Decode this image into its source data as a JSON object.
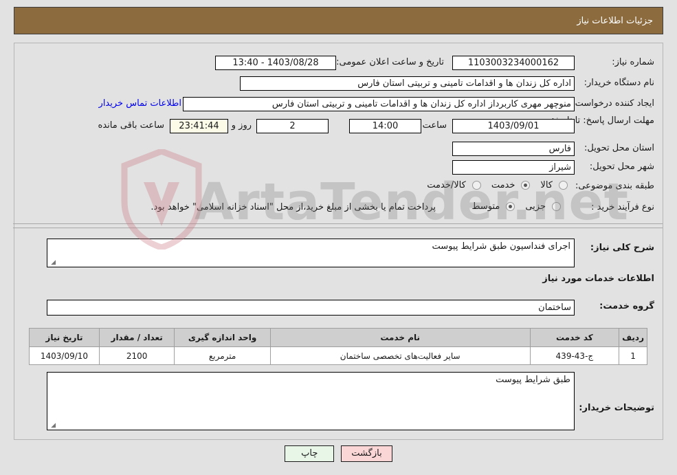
{
  "header": {
    "title": "جزئیات اطلاعات نیاز"
  },
  "fields": {
    "need_number_label": "شماره نیاز:",
    "need_number_value": "1103003234000162",
    "announce_label": "تاریخ و ساعت اعلان عمومی:",
    "announce_value": "1403/08/28 - 13:40",
    "buyer_org_label": "نام دستگاه خریدار:",
    "buyer_org_value": "اداره کل زندان ها و اقدامات تامینی و تربیتی استان فارس",
    "creator_label": "ایجاد کننده درخواست:",
    "creator_value": "منوچهر  مهری  کاربرداز اداره کل زندان ها و اقدامات تامینی و تربیتی استان فارس",
    "contact_link": "اطلاعات تماس خریدار",
    "deadline_label": "مهلت ارسال پاسخ: تا تاریخ:",
    "deadline_date": "1403/09/01",
    "deadline_hour_label": "ساعت",
    "deadline_hour": "14:00",
    "remaining_days": "2",
    "remaining_days_label": "روز و",
    "remaining_time": "23:41:44",
    "remaining_time_label": "ساعت باقی مانده",
    "province_label": "استان محل تحویل:",
    "province_value": "فارس",
    "city_label": "شهر محل تحویل:",
    "city_value": "شیراز",
    "category_label": "طبقه بندی موضوعی:",
    "process_label": "نوع فرآیند خرید :",
    "payment_note": "پرداخت تمام یا بخشی از مبلغ خرید،از محل \"اسناد خزانه اسلامی\" خواهد بود.",
    "general_desc_label": "شرح کلی نیاز:",
    "general_desc_value": "اجرای فنداسیون  طبق شرایط پیوست",
    "services_section_title": "اطلاعات خدمات مورد نیاز",
    "service_group_label": "گروه خدمت:",
    "service_group_value": "ساختمان",
    "buyer_notes_label": "توضیحات خریدار:",
    "buyer_notes_value": "طبق شرایط پیوست"
  },
  "category_options": [
    {
      "label": "کالا",
      "selected": false
    },
    {
      "label": "خدمت",
      "selected": true
    },
    {
      "label": "کالا/خدمت",
      "selected": false
    }
  ],
  "process_options": [
    {
      "label": "جزیی",
      "selected": false
    },
    {
      "label": "متوسط",
      "selected": true
    }
  ],
  "table": {
    "headers": [
      "ردیف",
      "کد خدمت",
      "نام خدمت",
      "واحد اندازه گیری",
      "تعداد / مقدار",
      "تاریخ نیاز"
    ],
    "rows": [
      {
        "radif": "1",
        "code": "ج-43-439",
        "name": "سایر فعالیت‌های تخصصی ساختمان",
        "unit": "مترمربع",
        "qty": "2100",
        "date": "1403/09/10"
      }
    ]
  },
  "buttons": {
    "print": "چاپ",
    "back": "بازگشت"
  },
  "watermark": {
    "text": "ArtaTender.net"
  },
  "colors": {
    "header_bar": "#8c6c3f",
    "page_bg": "#e2e2e2",
    "link": "#0000ee",
    "table_header": "#cfcfcf",
    "btn_print": "#e8f6e8",
    "btn_back": "#fbd6d6"
  }
}
